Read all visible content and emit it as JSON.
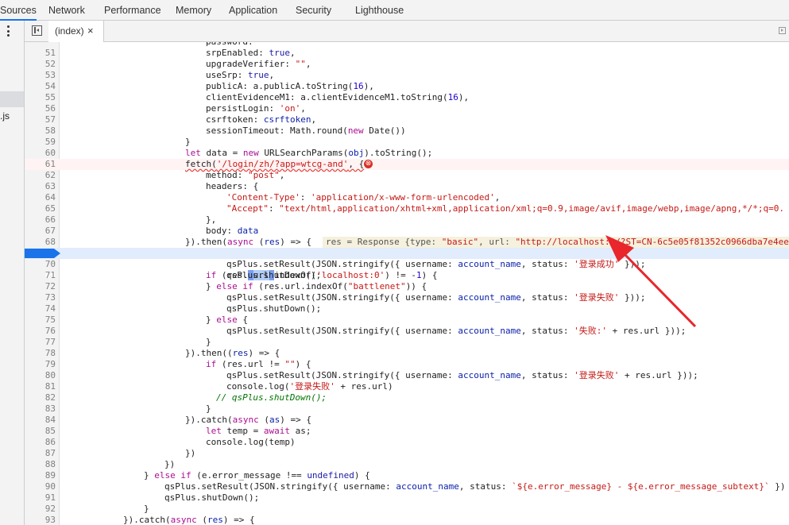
{
  "devtools_tabs": [
    "Sources",
    "Network",
    "Performance",
    "Memory",
    "Application",
    "Security",
    "Lighthouse"
  ],
  "navigator": {
    "file_fragment": ".js"
  },
  "editor_tab": {
    "label": "(index)",
    "close": "×"
  },
  "error_icon": "⊗",
  "inline_value": {
    "name": "res",
    "eq": " = ",
    "type_word": "Response {type: ",
    "type_value": "\"basic\"",
    "url_word": ", url: ",
    "url_value": "\"http://localhost:0/?ST=CN-6c5e05f81352c0966dba7e4ee"
  },
  "code": {
    "l51": {
      "num": "51",
      "a": "srpEnabled: ",
      "b": "true",
      "c": ","
    },
    "l52": {
      "num": "52",
      "a": "upgradeVerifier: ",
      "b": "\"\"",
      "c": ","
    },
    "l53": {
      "num": "53",
      "a": "useSrp: ",
      "b": "true",
      "c": ","
    },
    "l54": {
      "num": "54",
      "a": "publicA: a.publicA.toString(",
      "b": "16",
      "c": "),"
    },
    "l55": {
      "num": "55",
      "a": "clientEvidenceM1: a.clientEvidenceM1.toString(",
      "b": "16",
      "c": "),"
    },
    "l56": {
      "num": "56",
      "a": "persistLogin: ",
      "b": "'on'",
      "c": ","
    },
    "l57": {
      "num": "57",
      "a": "csrftoken: ",
      "b": "csrftoken",
      "c": ","
    },
    "l58": {
      "num": "58",
      "a": "sessionTimeout: Math.round(",
      "b": "new",
      "c": " Date())"
    },
    "l59": {
      "num": "59",
      "a": "}"
    },
    "l60": {
      "num": "60",
      "a": "let",
      "b": " data = ",
      "c": "new",
      "d": " URLSearchParams(",
      "e": "obj",
      "f": ").toString();"
    },
    "l61": {
      "num": "61",
      "a": "fetch(",
      "b": "'/login/zh/?app=wtcg-and'",
      "c": ", {"
    },
    "l62": {
      "num": "62",
      "a": "method: ",
      "b": "\"post\"",
      "c": ","
    },
    "l63": {
      "num": "63",
      "a": "headers: {"
    },
    "l64": {
      "num": "64",
      "a": "'Content-Type'",
      "b": ": ",
      "c": "'application/x-www-form-urlencoded'",
      "d": ","
    },
    "l65": {
      "num": "65",
      "a": "\"Accept\"",
      "b": ": ",
      "c": "\"text/html,application/xhtml+xml,application/xml;q=0.9,image/avif,image/webp,image/apng,*/*;q=0."
    },
    "l66": {
      "num": "66",
      "a": "},"
    },
    "l67": {
      "num": "67",
      "a": "body: ",
      "b": "data"
    },
    "l68": {
      "num": "68",
      "a": "}).then(",
      "b": "async",
      "c": " (",
      "d": "res",
      "e": ") => {"
    },
    "l69": {
      "num": "69",
      "a": "if",
      "b": " (res.",
      "c": "url",
      "d": "indexOf(",
      "e": "'localhost:0'",
      "f": ") != -",
      "g": "1",
      "h": ") {"
    },
    "l70": {
      "num": "70",
      "a": "qsPlus.setResult(JSON.stringify({ username: ",
      "b": "account_name",
      "c": ", status: ",
      "d": "'登录成功'",
      "e": " }));"
    },
    "l71": {
      "num": "71",
      "a": "qsPlus.shutDown();"
    },
    "l72": {
      "num": "72",
      "a": "} ",
      "b": "else if",
      "c": " (res.url.indexOf(",
      "d": "\"battlenet\"",
      "e": ")) {"
    },
    "l73": {
      "num": "73",
      "a": "qsPlus.setResult(JSON.stringify({ username: ",
      "b": "account_name",
      "c": ", status: ",
      "d": "'登录失败'",
      "e": " }));"
    },
    "l74": {
      "num": "74",
      "a": "qsPlus.shutDown();"
    },
    "l75": {
      "num": "75",
      "a": "} ",
      "b": "else",
      "c": " {"
    },
    "l76": {
      "num": "76",
      "a": "qsPlus.setResult(JSON.stringify({ username: ",
      "b": "account_name",
      "c": ", status: ",
      "d": "'失败:'",
      "e": " + res.url }));"
    },
    "l77": {
      "num": "77",
      "a": "}"
    },
    "l78": {
      "num": "78",
      "a": "}).then((",
      "b": "res",
      "c": ") => {"
    },
    "l79": {
      "num": "79",
      "a": "if",
      "b": " (res.url != ",
      "c": "\"\"",
      "d": ") {"
    },
    "l80": {
      "num": "80",
      "a": "qsPlus.setResult(JSON.stringify({ username: ",
      "b": "account_name",
      "c": ", status: ",
      "d": "'登录失败'",
      "e": " + res.url }));"
    },
    "l81": {
      "num": "81",
      "a": "console.log(",
      "b": "'登录失败'",
      "c": " + res.url)"
    },
    "l82": {
      "num": "82",
      "a": "// qsPlus.shutDown();"
    },
    "l83": {
      "num": "83",
      "a": "}"
    },
    "l84": {
      "num": "84",
      "a": "}).catch(",
      "b": "async",
      "c": " (",
      "d": "as",
      "e": ") => {"
    },
    "l85": {
      "num": "85",
      "a": "let",
      "b": " temp = ",
      "c": "await",
      "d": " as;"
    },
    "l86": {
      "num": "86",
      "a": "console.log(temp)"
    },
    "l87": {
      "num": "87",
      "a": "})"
    },
    "l88": {
      "num": "88",
      "a": "})"
    },
    "l89": {
      "num": "89",
      "a": "} ",
      "b": "else if",
      "c": " (e.error_message !== ",
      "d": "undefined",
      "e": ") {"
    },
    "l90": {
      "num": "90",
      "a": "qsPlus.setResult(JSON.stringify({ username: ",
      "b": "account_name",
      "c": ", status: ",
      "d": "`${e.error_message} - ${e.error_message_subtext}`",
      "e": " })"
    },
    "l91": {
      "num": "91",
      "a": "qsPlus.shutDown();"
    },
    "l92": {
      "num": "92",
      "a": "}"
    },
    "l93": {
      "num": "93",
      "a": "}).catch(",
      "b": "async",
      "c": " (",
      "d": "res",
      "e": ") => {"
    }
  },
  "colors": {
    "accent": "#1a73e8",
    "breakpoint": "#1a73e8",
    "arrow": "#e8262b",
    "exec_line": "#e1ecfd",
    "inline_value_bg": "#f5f1de"
  }
}
